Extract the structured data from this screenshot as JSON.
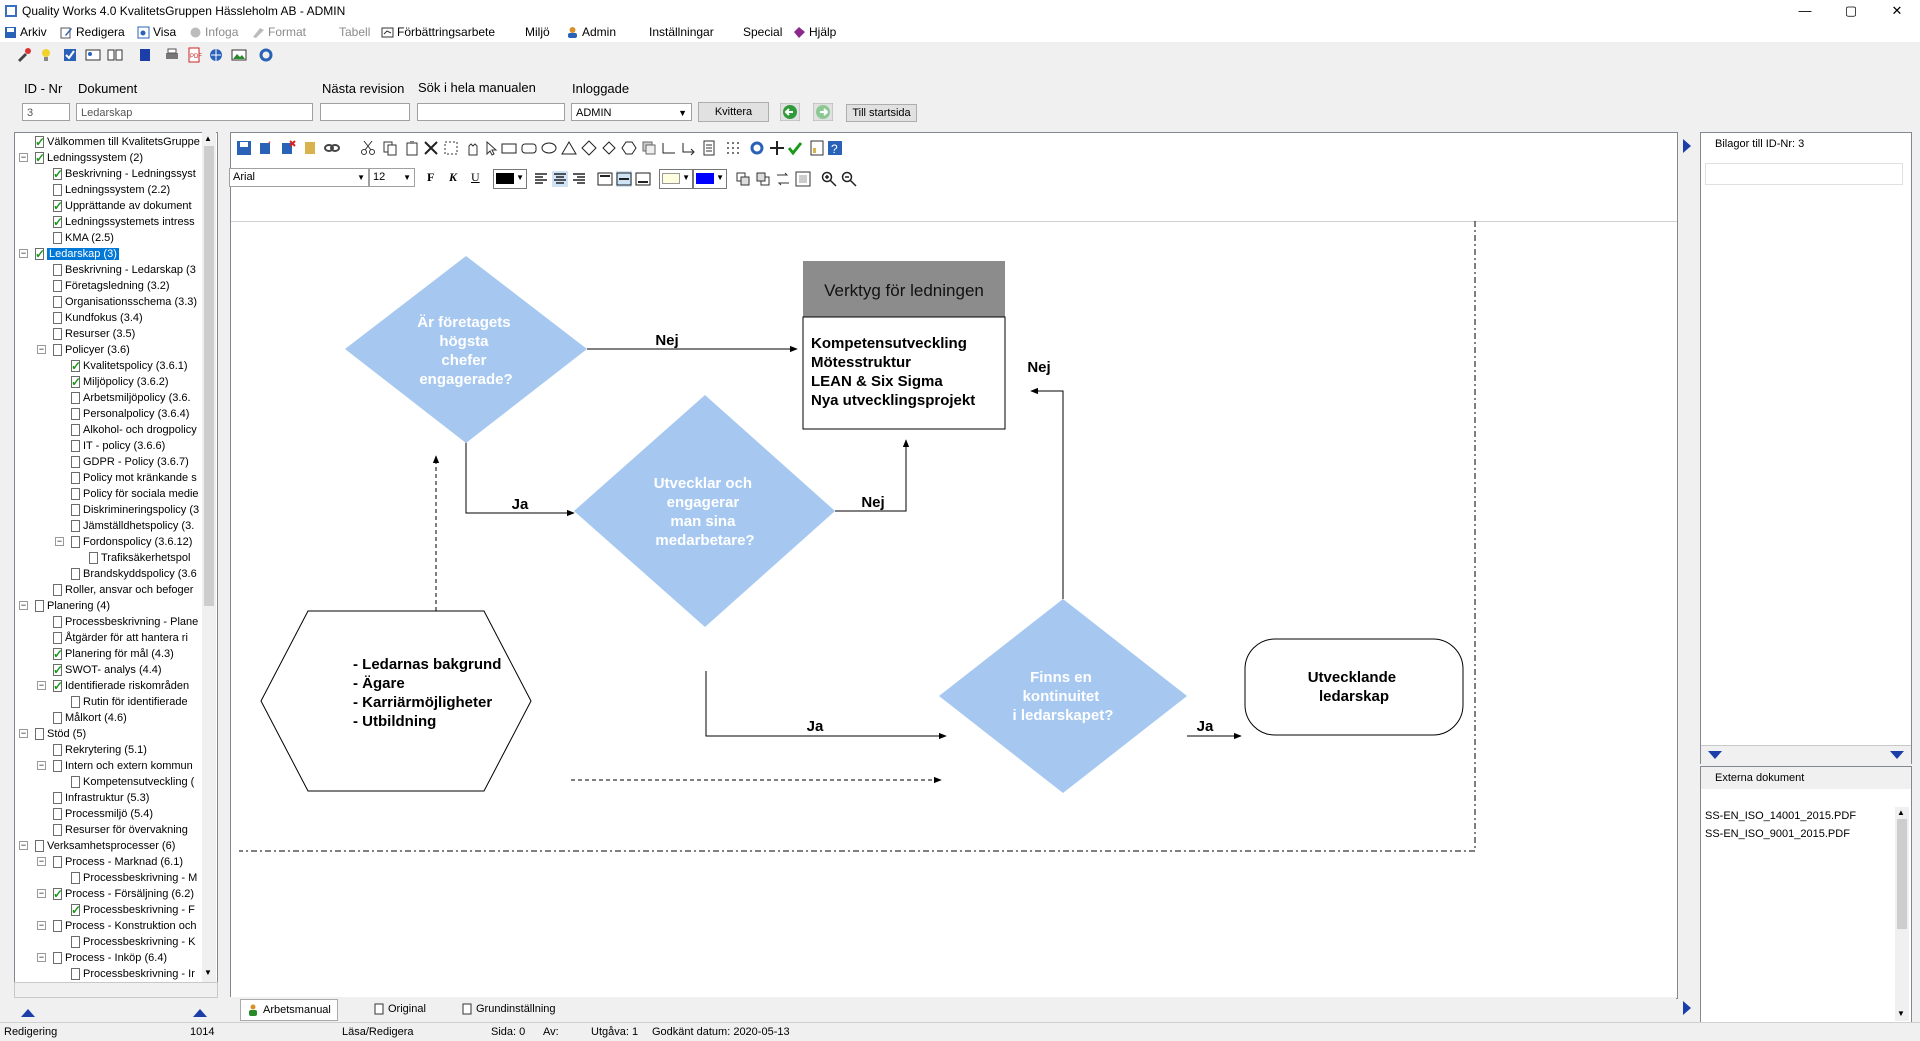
{
  "window": {
    "title": "Quality Works 4.0 KvalitetsGruppen Hässleholm AB - ADMIN",
    "buttons": [
      "—",
      "▢",
      "✕"
    ]
  },
  "menu": [
    {
      "label": "Arkiv",
      "icon": "save-icon",
      "disabled": false
    },
    {
      "label": "Redigera",
      "icon": "edit-icon",
      "disabled": false
    },
    {
      "label": "Visa",
      "icon": "view-icon",
      "disabled": false
    },
    {
      "label": "Infoga",
      "icon": "insert-icon",
      "disabled": true
    },
    {
      "label": "Format",
      "icon": "format-icon",
      "disabled": true
    },
    {
      "label": "Tabell",
      "icon": "",
      "disabled": true
    },
    {
      "label": "Förbättringsarbete",
      "icon": "improvement-icon",
      "disabled": false
    },
    {
      "label": "Miljö",
      "icon": "",
      "disabled": false
    },
    {
      "label": "Admin",
      "icon": "admin-icon",
      "disabled": false
    },
    {
      "label": "Inställningar",
      "icon": "",
      "disabled": false
    },
    {
      "label": "Special",
      "icon": "",
      "disabled": false
    },
    {
      "label": "Hjälp",
      "icon": "help-icon",
      "disabled": false
    }
  ],
  "form": {
    "id_label": "ID - Nr",
    "doc_label": "Dokument",
    "next_rev_label": "Nästa revision",
    "search_label": "Sök i hela manualen",
    "logged_label": "Inloggade",
    "id_value": "3",
    "doc_value": "Ledarskap",
    "next_rev_value": "",
    "search_value": "",
    "logged_value": "ADMIN",
    "kvittera": "Kvittera",
    "startsida": "Till startsida"
  },
  "tree": [
    {
      "label": "Välkommen till KvalitetsGruppe",
      "level": 1,
      "chk": true,
      "exp": ""
    },
    {
      "label": "Ledningssystem (2)",
      "level": 1,
      "chk": true,
      "exp": "−"
    },
    {
      "label": "Beskrivning - Ledningssyst",
      "level": 2,
      "chk": true,
      "exp": ""
    },
    {
      "label": "Ledningssystem (2.2)",
      "level": 2,
      "chk": false,
      "exp": ""
    },
    {
      "label": "Upprättande av dokument",
      "level": 2,
      "chk": true,
      "exp": ""
    },
    {
      "label": "Ledningssystemets intress",
      "level": 2,
      "chk": true,
      "exp": ""
    },
    {
      "label": "KMA (2.5)",
      "level": 2,
      "chk": false,
      "exp": ""
    },
    {
      "label": "Ledarskap (3)",
      "level": 1,
      "chk": true,
      "exp": "−",
      "selected": true
    },
    {
      "label": "Beskrivning - Ledarskap (3",
      "level": 2,
      "chk": false,
      "exp": ""
    },
    {
      "label": "Företagsledning (3.2)",
      "level": 2,
      "chk": false,
      "exp": ""
    },
    {
      "label": "Organisationsschema (3.3)",
      "level": 2,
      "chk": false,
      "exp": ""
    },
    {
      "label": "Kundfokus (3.4)",
      "level": 2,
      "chk": false,
      "exp": ""
    },
    {
      "label": "Resurser (3.5)",
      "level": 2,
      "chk": false,
      "exp": ""
    },
    {
      "label": "Policyer (3.6)",
      "level": 2,
      "chk": false,
      "exp": "−"
    },
    {
      "label": "Kvalitetspolicy (3.6.1)",
      "level": 3,
      "chk": true,
      "exp": ""
    },
    {
      "label": "Miljöpolicy (3.6.2)",
      "level": 3,
      "chk": true,
      "exp": ""
    },
    {
      "label": "Arbetsmiljöpolicy (3.6.",
      "level": 3,
      "chk": false,
      "exp": ""
    },
    {
      "label": "Personalpolicy (3.6.4)",
      "level": 3,
      "chk": false,
      "exp": ""
    },
    {
      "label": "Alkohol- och drogpolicy",
      "level": 3,
      "chk": false,
      "exp": ""
    },
    {
      "label": "IT - policy (3.6.6)",
      "level": 3,
      "chk": false,
      "exp": ""
    },
    {
      "label": "GDPR - Policy (3.6.7)",
      "level": 3,
      "chk": false,
      "exp": ""
    },
    {
      "label": "Policy mot kränkande s",
      "level": 3,
      "chk": false,
      "exp": ""
    },
    {
      "label": "Policy för sociala medie",
      "level": 3,
      "chk": false,
      "exp": ""
    },
    {
      "label": "Diskrimineringspolicy (3",
      "level": 3,
      "chk": false,
      "exp": ""
    },
    {
      "label": "Jämställdhetspolicy (3.",
      "level": 3,
      "chk": false,
      "exp": ""
    },
    {
      "label": "Fordonspolicy (3.6.12)",
      "level": 3,
      "chk": false,
      "exp": "−"
    },
    {
      "label": "Trafiksäkerhetspol",
      "level": 4,
      "chk": false,
      "exp": ""
    },
    {
      "label": "Brandskyddspolicy (3.6",
      "level": 3,
      "chk": false,
      "exp": ""
    },
    {
      "label": "Roller, ansvar och befoger",
      "level": 2,
      "chk": false,
      "exp": ""
    },
    {
      "label": "Planering (4)",
      "level": 1,
      "chk": false,
      "exp": "−"
    },
    {
      "label": "Processbeskrivning - Plane",
      "level": 2,
      "chk": false,
      "exp": ""
    },
    {
      "label": "Åtgärder för att hantera ri",
      "level": 2,
      "chk": false,
      "exp": ""
    },
    {
      "label": "Planering för mål (4.3)",
      "level": 2,
      "chk": true,
      "exp": ""
    },
    {
      "label": "SWOT- analys (4.4)",
      "level": 2,
      "chk": true,
      "exp": ""
    },
    {
      "label": "Identifierade riskområden",
      "level": 2,
      "chk": true,
      "exp": "−"
    },
    {
      "label": "Rutin för identifierade",
      "level": 3,
      "chk": false,
      "exp": ""
    },
    {
      "label": "Målkort (4.6)",
      "level": 2,
      "chk": false,
      "exp": ""
    },
    {
      "label": "Stöd (5)",
      "level": 1,
      "chk": false,
      "exp": "−"
    },
    {
      "label": "Rekrytering (5.1)",
      "level": 2,
      "chk": false,
      "exp": ""
    },
    {
      "label": "Intern och extern kommun",
      "level": 2,
      "chk": false,
      "exp": "−"
    },
    {
      "label": "Kompetensutveckling (",
      "level": 3,
      "chk": false,
      "exp": ""
    },
    {
      "label": "Infrastruktur (5.3)",
      "level": 2,
      "chk": false,
      "exp": ""
    },
    {
      "label": "Processmiljö (5.4)",
      "level": 2,
      "chk": false,
      "exp": ""
    },
    {
      "label": "Resurser för övervakning",
      "level": 2,
      "chk": false,
      "exp": ""
    },
    {
      "label": "Verksamhetsprocesser (6)",
      "level": 1,
      "chk": false,
      "exp": "−"
    },
    {
      "label": "Process - Marknad (6.1)",
      "level": 2,
      "chk": false,
      "exp": "−"
    },
    {
      "label": "Processbeskrivning - M",
      "level": 3,
      "chk": false,
      "exp": ""
    },
    {
      "label": "Process - Försäljning (6.2)",
      "level": 2,
      "chk": true,
      "exp": "−"
    },
    {
      "label": "Processbeskrivning - F",
      "level": 3,
      "chk": true,
      "exp": ""
    },
    {
      "label": "Process - Konstruktion och",
      "level": 2,
      "chk": false,
      "exp": "−"
    },
    {
      "label": "Processbeskrivning - K",
      "level": 3,
      "chk": false,
      "exp": ""
    },
    {
      "label": "Process - Inköp (6.4)",
      "level": 2,
      "chk": false,
      "exp": "−"
    },
    {
      "label": "Processbeskrivning - Ir",
      "level": 3,
      "chk": false,
      "exp": ""
    }
  ],
  "editor": {
    "font": "Arial",
    "size": "12"
  },
  "flow": {
    "d1": [
      "Är företagets",
      "högsta",
      "chefer",
      "engagerade?"
    ],
    "d2": [
      "Utvecklar och",
      "engagerar",
      "man sina",
      "medarbetare?"
    ],
    "d3": [
      "Finns en",
      "kontinuitet",
      "i ledarskapet?"
    ],
    "box_title": "Verktyg för ledningen",
    "box_items": [
      "Kompetensutveckling",
      "Mötesstruktur",
      "LEAN & Six Sigma",
      "Nya utvecklingsprojekt"
    ],
    "hex_items": [
      "- Ledarnas bakgrund",
      "- Ägare",
      "- Karriärmöjligheter",
      "- Utbildning"
    ],
    "term": [
      "Utvecklande",
      "ledarskap"
    ],
    "nej1": "Nej",
    "nej2": "Nej",
    "nej3": "Nej",
    "ja1": "Ja",
    "ja2": "Ja",
    "ja3": "Ja"
  },
  "tabs": [
    "Arbetsmanual",
    "Original",
    "Grundinställning"
  ],
  "right": {
    "bilagor": "Bilagor till ID-Nr: 3",
    "externa": "Externa dokument",
    "files": [
      "SS-EN_ISO_14001_2015.PDF",
      "SS-EN_ISO_9001_2015.PDF"
    ]
  },
  "status": {
    "mode": "Redigering",
    "count": "1014",
    "access": "Läsa/Redigera",
    "page": "Sida: 0",
    "av": "Av:",
    "utgava": "Utgåva: 1",
    "godkant": "Godkänt datum: 2020-05-13"
  },
  "colors": {
    "diamond": "#a6c8f0",
    "box_header": "#8c8c8c",
    "accent": "#0078d7"
  }
}
